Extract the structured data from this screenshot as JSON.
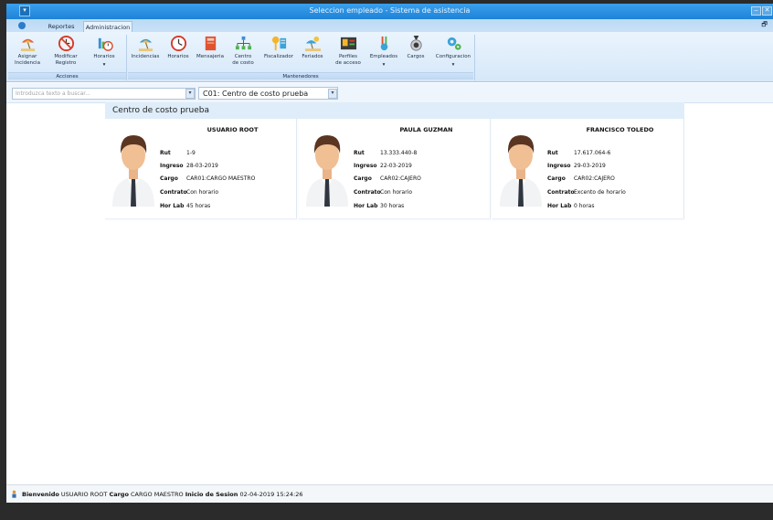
{
  "window": {
    "title": "Seleccion empleado - Sistema de asistencia",
    "menu_glyph": "▾",
    "minimize_glyph": "–",
    "close_glyph": "✕",
    "restore_glyph": "🗗"
  },
  "tabs": [
    {
      "label": "Reportes",
      "active": false
    },
    {
      "label": "Administracion",
      "active": true
    }
  ],
  "ribbon": {
    "groups": [
      {
        "label": "Acciones",
        "buttons": [
          {
            "label": "Asignar\nIncidencia",
            "icon": "beach-umbrella-icon"
          },
          {
            "label": "Modificar\nRegistro",
            "icon": "no-entry-clock-icon"
          },
          {
            "label": "Horarios",
            "icon": "chart-clock-icon",
            "menu": true
          }
        ]
      },
      {
        "label": "Mantenedores",
        "buttons": [
          {
            "label": "Incidencias",
            "icon": "beach-umbrella-icon"
          },
          {
            "label": "Horarios",
            "icon": "clock-icon"
          },
          {
            "label": "Mensajeria",
            "icon": "book-icon"
          },
          {
            "label": "Centro\nde costo",
            "icon": "org-chart-icon"
          },
          {
            "label": "Fiscalizador",
            "icon": "keys-icon"
          },
          {
            "label": "Feriados",
            "icon": "beach-icon"
          },
          {
            "label": "Perfiles\nde acceso",
            "icon": "id-card-icon"
          },
          {
            "label": "Empleados",
            "icon": "employees-icon",
            "menu": true
          },
          {
            "label": "Cargos",
            "icon": "medal-icon"
          },
          {
            "label": "Configuracion",
            "icon": "gears-icon",
            "menu": true
          }
        ]
      }
    ],
    "menu_glyph": "▾"
  },
  "filter": {
    "search_placeholder": "Introduzca texto a buscar...",
    "cost_center_value": "C01: Centro de costo prueba",
    "dropdown_glyph": "▾"
  },
  "cost_center_header": "Centro de costo prueba",
  "field_labels": {
    "rut": "Rut",
    "ingreso": "Ingreso",
    "cargo": "Cargo",
    "contrato": "Contrato",
    "horlab": "Hor Lab"
  },
  "employees": [
    {
      "name": "USUARIO ROOT",
      "rut": "1-9",
      "ingreso": "28-03-2019",
      "cargo": "CAR01:CARGO MAESTRO",
      "contrato": "Con horario",
      "horlab": "45 horas"
    },
    {
      "name": "PAULA GUZMAN",
      "rut": "13.333.440-8",
      "ingreso": "22-03-2019",
      "cargo": "CAR02:CAJERO",
      "contrato": "Con horario",
      "horlab": "30 horas"
    },
    {
      "name": "FRANCISCO TOLEDO",
      "rut": "17.617.064-6",
      "ingreso": "29-03-2019",
      "cargo": "CAR02:CAJERO",
      "contrato": "Excento de horario",
      "horlab": "0 horas"
    }
  ],
  "status": {
    "welcome_label": "Bienvenido",
    "user": "USUARIO ROOT",
    "cargo_label": "Cargo",
    "cargo": "CARGO MAESTRO",
    "session_label": "Inicio de Sesion",
    "session_start": "02-04-2019 15:24:26"
  },
  "colors": {
    "title_bar": "#1e82d8",
    "ribbon_bg": "#d6e8f9",
    "header_bg": "#deedf9"
  }
}
